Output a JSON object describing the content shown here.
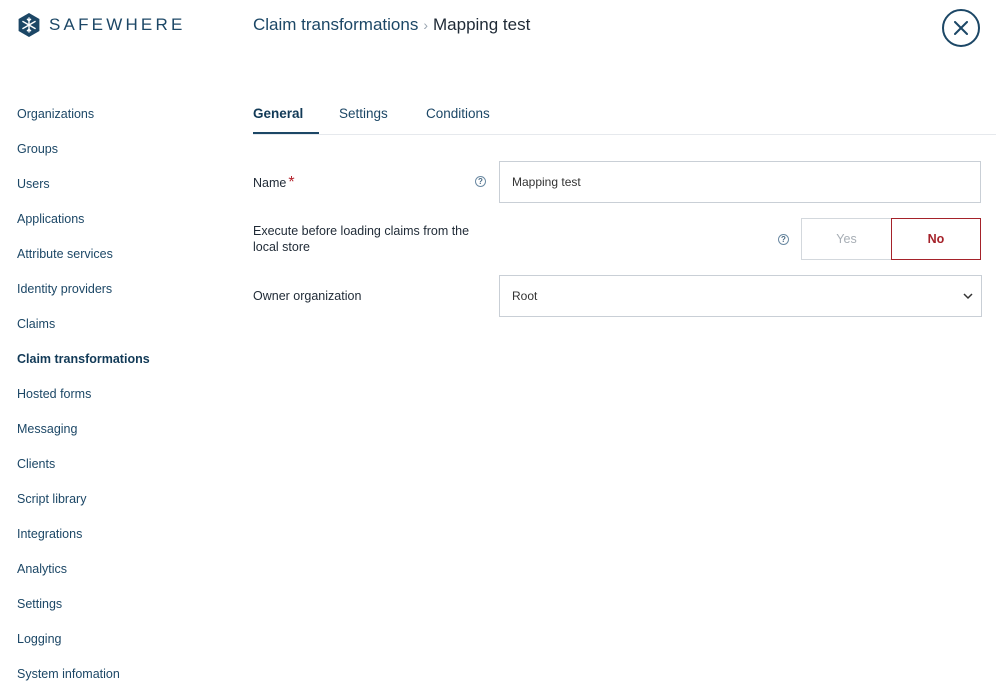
{
  "app": {
    "brand": "SAFEWHERE",
    "logo_icon": "snowflake-icon",
    "accent_color": "#1c4766",
    "danger_color": "#a5222a"
  },
  "breadcrumb": {
    "parent": "Claim transformations",
    "separator": "›",
    "current": "Mapping test"
  },
  "header": {
    "close_icon": "close-icon"
  },
  "sidebar": {
    "items": [
      {
        "label": "Organizations",
        "active": false
      },
      {
        "label": "Groups",
        "active": false
      },
      {
        "label": "Users",
        "active": false
      },
      {
        "label": "Applications",
        "active": false
      },
      {
        "label": "Attribute services",
        "active": false
      },
      {
        "label": "Identity providers",
        "active": false
      },
      {
        "label": "Claims",
        "active": false
      },
      {
        "label": "Claim transformations",
        "active": true
      },
      {
        "label": "Hosted forms",
        "active": false
      },
      {
        "label": "Messaging",
        "active": false
      },
      {
        "label": "Clients",
        "active": false
      },
      {
        "label": "Script library",
        "active": false
      },
      {
        "label": "Integrations",
        "active": false
      },
      {
        "label": "Analytics",
        "active": false
      },
      {
        "label": "Settings",
        "active": false
      },
      {
        "label": "Logging",
        "active": false
      },
      {
        "label": "System infomation",
        "active": false
      }
    ]
  },
  "tabs": [
    {
      "label": "General",
      "active": true
    },
    {
      "label": "Settings",
      "active": false
    },
    {
      "label": "Conditions",
      "active": false
    }
  ],
  "form": {
    "name": {
      "label": "Name",
      "required_mark": "*",
      "value": "Mapping test",
      "help_icon": "help-icon"
    },
    "execute_before": {
      "label": "Execute before loading claims from the local store",
      "help_icon": "help-icon",
      "yes_label": "Yes",
      "no_label": "No",
      "selected": "No"
    },
    "owner": {
      "label": "Owner organization",
      "value": "Root",
      "chevron_icon": "chevron-down-icon"
    }
  }
}
